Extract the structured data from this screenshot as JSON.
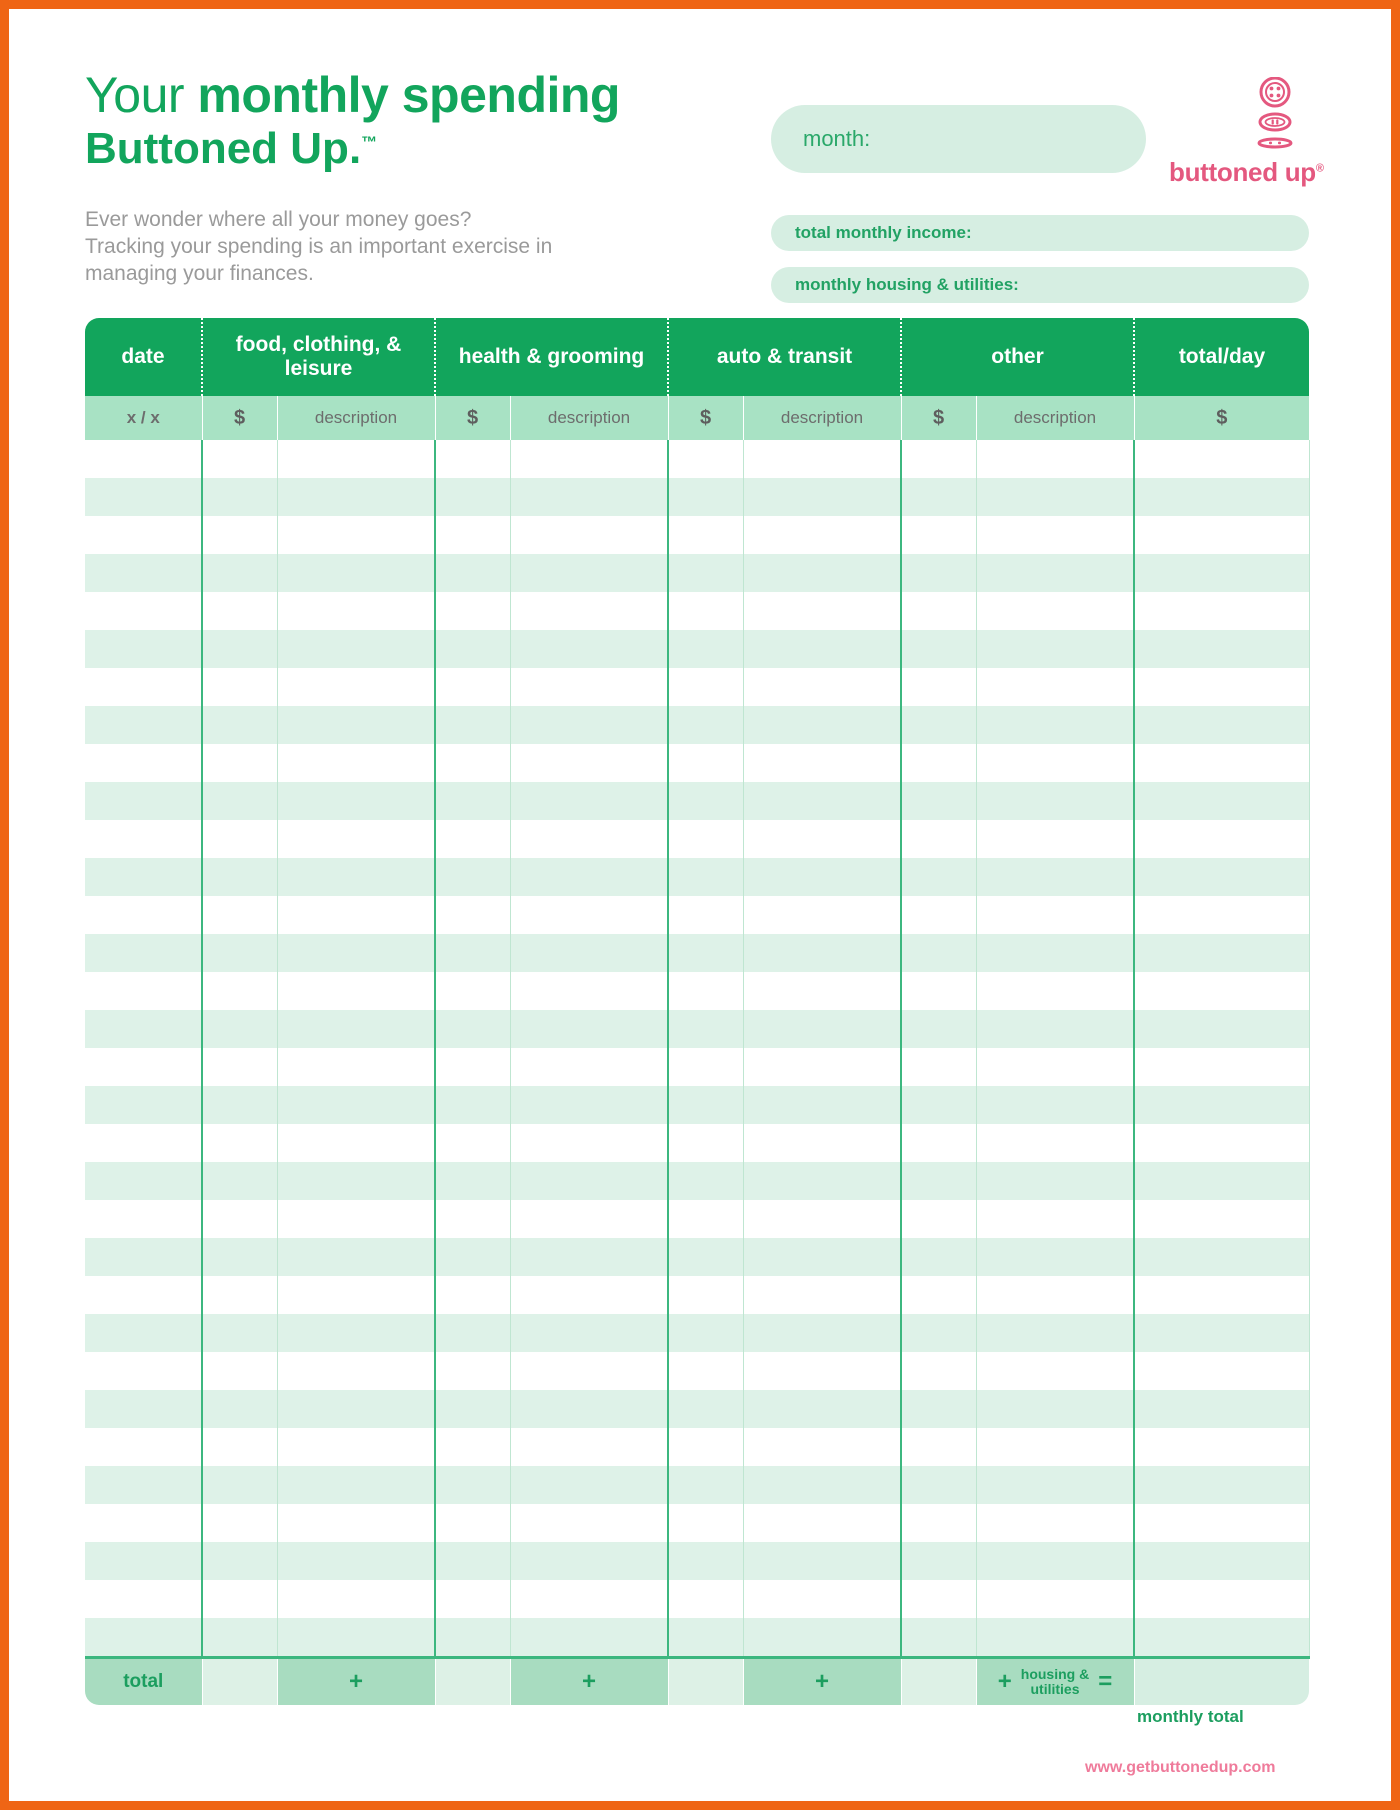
{
  "brand": {
    "name": "buttoned up",
    "registered_mark": "®",
    "accent_pink": "#e4587f",
    "accent_green": "#12a55c",
    "accent_orange": "#ef6515",
    "website": "www.getbuttonedup.com"
  },
  "header": {
    "title_prefix": "Your ",
    "title_strong": "monthly spending",
    "title_line2": "Buttoned Up",
    "title_line2_punct": ".",
    "trademark": "™",
    "subtitle": "Ever wonder where all your money goes? Tracking your spending is an important exercise in managing your finances."
  },
  "fields": {
    "month_label": "month:",
    "month_value": "",
    "income_label": "total monthly income:",
    "income_value": "",
    "housing_label": "monthly housing & utilities:",
    "housing_value": ""
  },
  "table": {
    "group_headers": [
      "date",
      "food, clothing, & leisure",
      "health & grooming",
      "auto & transit",
      "other",
      "total/day"
    ],
    "sub_headers": [
      "x / x",
      "$",
      "description",
      "$",
      "description",
      "$",
      "description",
      "$",
      "description",
      "$"
    ],
    "row_count": 32,
    "rows": []
  },
  "totals": {
    "label": "total",
    "plus": "+",
    "equals": "=",
    "housing_utilities_line1": "housing &",
    "housing_utilities_line2": "utilities",
    "monthly_total_label": "monthly total",
    "values": {
      "food_clothing_leisure": "",
      "health_grooming": "",
      "auto_transit": "",
      "other": "",
      "monthly_total": ""
    }
  },
  "colors": {
    "header_green": "#12a55c",
    "subheader_mint": "#a8e2c4",
    "row_stripe": "#def2e8",
    "pill_mint": "#d6eee2",
    "grid_line": "#3cb77f",
    "text_gray": "#9a9a9a"
  }
}
